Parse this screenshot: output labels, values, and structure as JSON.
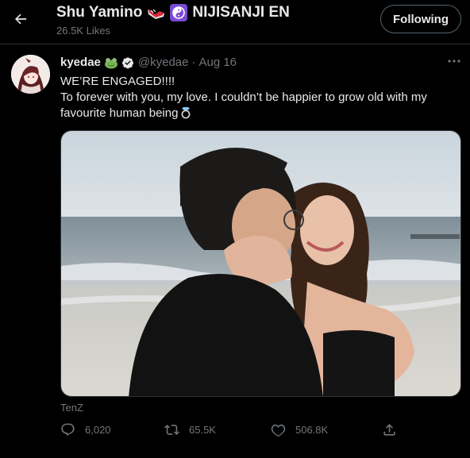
{
  "header": {
    "back_icon": "arrow-left-icon",
    "profile_name": "Shu Yamino",
    "name_emojis": [
      "running-shoe-emoji",
      "yin-yang-emoji"
    ],
    "affiliation": "NIJISANJI EN",
    "likes": "26.5K Likes",
    "following_label": "Following"
  },
  "tweet": {
    "display_name": "kyedae",
    "name_emoji": "frog-emoji",
    "verified_icon": "verified-badge-icon",
    "handle": "@kyedae",
    "separator": "·",
    "date": "Aug 16",
    "more_icon": "more-icon",
    "text_line1": "WE’RE ENGAGED!!!!",
    "text_line2": "To forever with you, my love. I couldn’t be happier to grow old with my favourite human being",
    "text_emoji": "ring-emoji",
    "media_credit": "TenZ",
    "actions": {
      "reply_count": "6,020",
      "retweet_count": "65.5K",
      "like_count": "506.8K",
      "icons": [
        "reply-icon",
        "retweet-icon",
        "like-icon",
        "share-icon"
      ]
    }
  },
  "colors": {
    "background": "#000000",
    "text_primary": "#e7e9ea",
    "text_secondary": "#71767b",
    "border": "#2f3336",
    "verified": "#e7e9ea"
  }
}
